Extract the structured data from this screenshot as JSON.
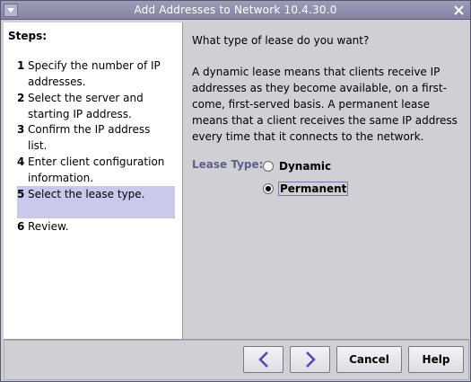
{
  "window": {
    "title": "Add Addresses to Network 10.4.30.0"
  },
  "steps": {
    "title": "Steps:",
    "items": [
      {
        "num": "1",
        "label": "Specify the number of IP addresses."
      },
      {
        "num": "2",
        "label": "Select the server and starting IP address."
      },
      {
        "num": "3",
        "label": "Confirm the IP address list."
      },
      {
        "num": "4",
        "label": "Enter client configuration information."
      },
      {
        "num": "5",
        "label": "Select the lease type."
      },
      {
        "num": "6",
        "label": "Review."
      }
    ],
    "active_index": 4
  },
  "content": {
    "question": "What type of lease do you want?",
    "description": "A dynamic lease means that clients receive IP addresses as they become available, on a first-come, first-served basis.  A permanent lease means that a client receives the same IP address every time that it connects to the network.",
    "lease_type_label": "Lease Type:",
    "options": [
      {
        "label": "Dynamic",
        "checked": false
      },
      {
        "label": "Permanent",
        "checked": true
      }
    ]
  },
  "buttons": {
    "back_icon": "chevron-left-icon",
    "next_icon": "chevron-right-icon",
    "cancel": "Cancel",
    "help": "Help"
  },
  "colors": {
    "titlebar": "#8f8fad",
    "active_step": "#c9c9ec",
    "lease_label": "#5f5f8f",
    "chevron": "#4a4ab8"
  }
}
